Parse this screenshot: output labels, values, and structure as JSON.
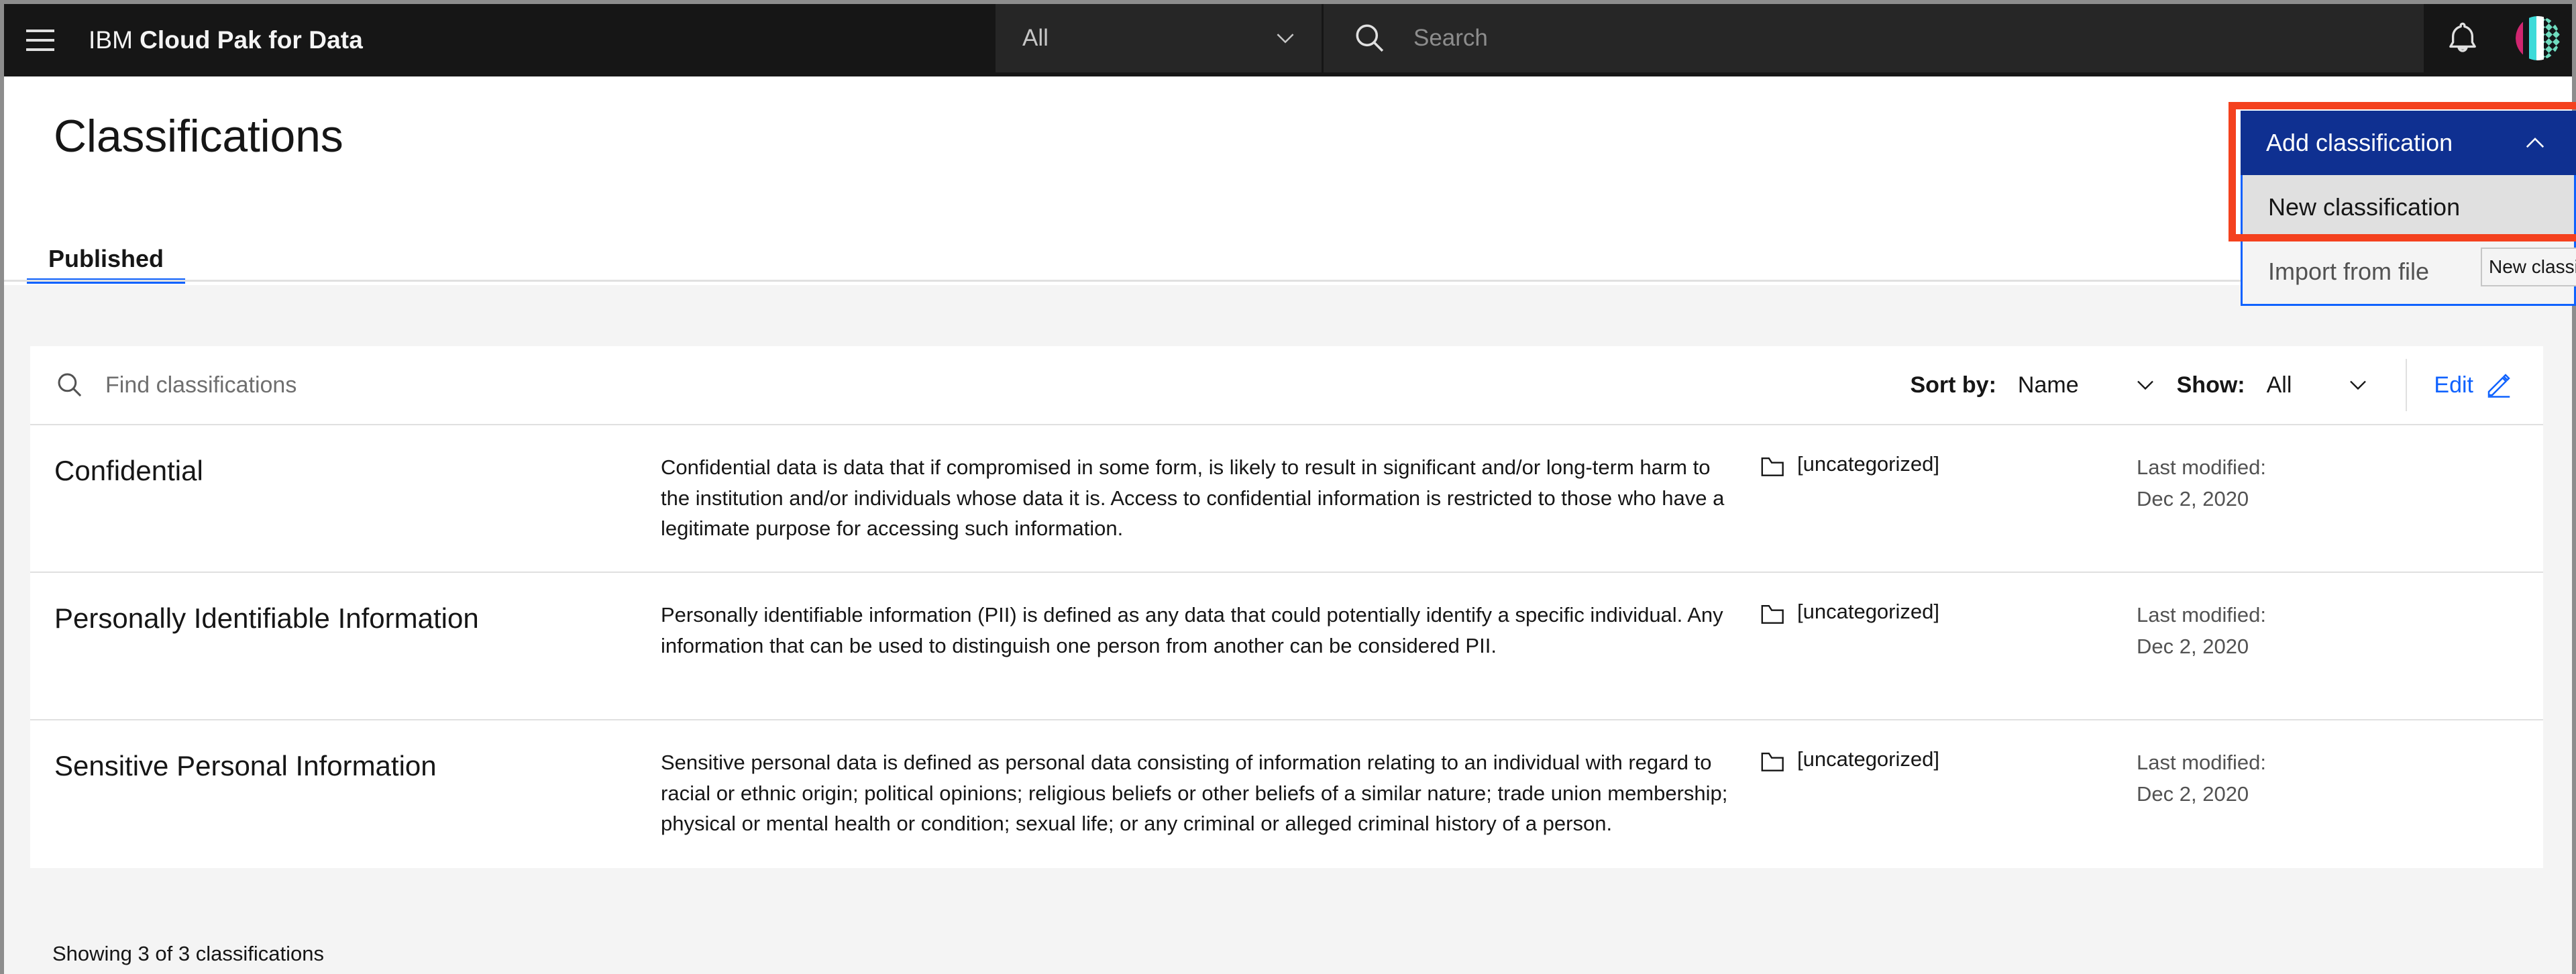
{
  "window": {
    "chrome_color": "#8d8d8d"
  },
  "header": {
    "menu_icon": "hamburger-icon",
    "brand_prefix": "IBM",
    "brand_product": "Cloud Pak for Data",
    "scope_value": "All",
    "scope_chevron": "chevron-down-icon",
    "search_icon": "search-icon",
    "search_placeholder": "Search",
    "search_value": "",
    "bell_icon": "notification-bell-icon",
    "avatar": "user-avatar",
    "bar_color": "#161616",
    "field_color": "#262626"
  },
  "page": {
    "title": "Classifications"
  },
  "tabs": [
    {
      "label": "Published",
      "active": true
    }
  ],
  "add_menu": {
    "button_label": "Add classification",
    "button_color": "#0f3091",
    "chevron": "chevron-up-icon",
    "expanded": true,
    "items": [
      {
        "label": "New classification",
        "highlighted": true
      },
      {
        "label": "Import from file",
        "highlighted": false
      }
    ],
    "border_color": "#0f62fe"
  },
  "annotation": {
    "color": "#f4411e",
    "shape": "rectangle"
  },
  "tooltip": {
    "text": "New classification"
  },
  "toolbar": {
    "search_icon": "search-icon",
    "search_placeholder": "Find classifications",
    "search_value": "",
    "sort_label": "Sort by:",
    "sort_value": "Name",
    "sort_chevron": "chevron-down-icon",
    "show_label": "Show:",
    "show_value": "All",
    "show_chevron": "chevron-down-icon",
    "edit_label": "Edit",
    "edit_icon": "pencil-icon",
    "accent_color": "#0f62fe"
  },
  "list": {
    "rows": [
      {
        "name": "Confidential",
        "description": "Confidential data is data that if compromised in some form, is likely to result in significant and/or long-term harm to the institution and/or individuals whose data it is. Access to confidential information is restricted to those who have a legitimate purpose for accessing such information.",
        "category_icon": "folder-icon",
        "category": "[uncategorized]",
        "modified_label": "Last modified:",
        "modified_date": "Dec 2, 2020"
      },
      {
        "name": "Personally Identifiable Information",
        "description": "Personally identifiable information (PII) is defined as any data that could potentially identify a specific individual. Any information that can be used to distinguish one person from another can be considered PII.",
        "category_icon": "folder-icon",
        "category": "[uncategorized]",
        "modified_label": "Last modified:",
        "modified_date": "Dec 2, 2020"
      },
      {
        "name": "Sensitive Personal Information",
        "description": "Sensitive personal data is defined as personal data consisting of information relating to an individual with regard to racial or ethnic origin; political opinions; religious beliefs or other beliefs of a similar nature; trade union membership; physical or mental health or condition; sexual life; or any criminal or alleged criminal history of a person.",
        "category_icon": "folder-icon",
        "category": "[uncategorized]",
        "modified_label": "Last modified:",
        "modified_date": "Dec 2, 2020"
      }
    ]
  },
  "footer": {
    "showing_text": "Showing 3 of 3 classifications"
  }
}
